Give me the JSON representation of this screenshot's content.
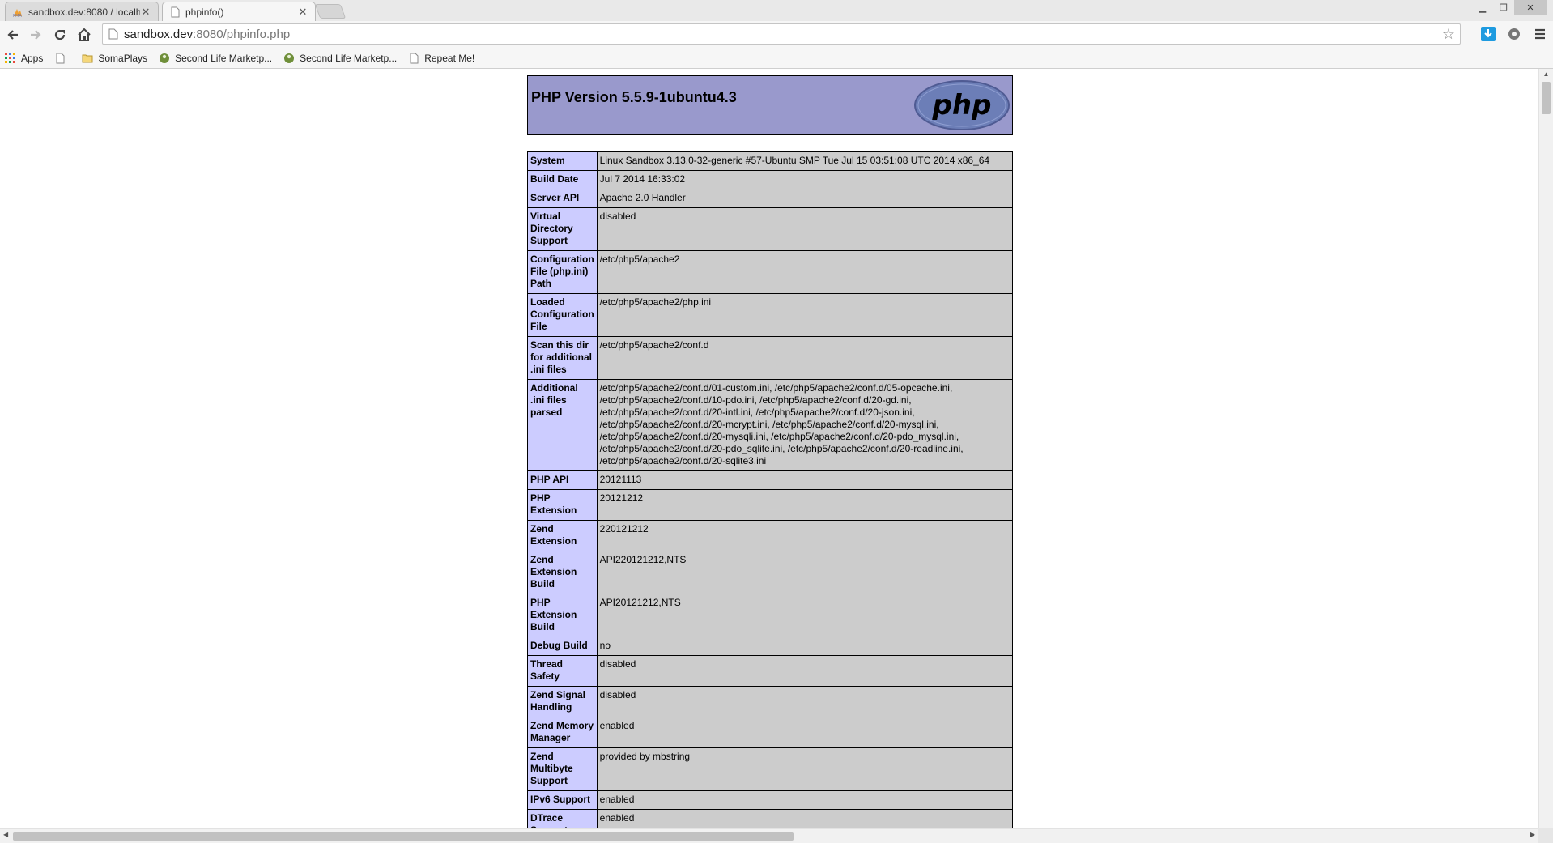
{
  "browser": {
    "tabs": [
      {
        "title": "sandbox.dev:8080 / localh",
        "active": false
      },
      {
        "title": "phpinfo()",
        "active": true
      }
    ],
    "address": {
      "host": "sandbox.dev",
      "path": ":8080/phpinfo.php"
    },
    "bookmarks": [
      {
        "label": "Apps",
        "icon": "apps-grid-icon"
      },
      {
        "label": "",
        "icon": "page-icon"
      },
      {
        "label": "SomaPlays",
        "icon": "folder-icon"
      },
      {
        "label": "Second Life Marketp...",
        "icon": "second-life-icon"
      },
      {
        "label": "Second Life Marketp...",
        "icon": "second-life-icon"
      },
      {
        "label": "Repeat Me!",
        "icon": "page-icon"
      }
    ]
  },
  "phpinfo": {
    "title": "PHP Version 5.5.9-1ubuntu4.3",
    "logo_text": "php",
    "rows": [
      {
        "k": "System",
        "v": "Linux Sandbox 3.13.0-32-generic #57-Ubuntu SMP Tue Jul 15 03:51:08 UTC 2014 x86_64"
      },
      {
        "k": "Build Date",
        "v": "Jul 7 2014 16:33:02"
      },
      {
        "k": "Server API",
        "v": "Apache 2.0 Handler"
      },
      {
        "k": "Virtual Directory Support",
        "v": "disabled"
      },
      {
        "k": "Configuration File (php.ini) Path",
        "v": "/etc/php5/apache2"
      },
      {
        "k": "Loaded Configuration File",
        "v": "/etc/php5/apache2/php.ini"
      },
      {
        "k": "Scan this dir for additional .ini files",
        "v": "/etc/php5/apache2/conf.d"
      },
      {
        "k": "Additional .ini files parsed",
        "v": "/etc/php5/apache2/conf.d/01-custom.ini, /etc/php5/apache2/conf.d/05-opcache.ini, /etc/php5/apache2/conf.d/10-pdo.ini, /etc/php5/apache2/conf.d/20-gd.ini, /etc/php5/apache2/conf.d/20-intl.ini, /etc/php5/apache2/conf.d/20-json.ini, /etc/php5/apache2/conf.d/20-mcrypt.ini, /etc/php5/apache2/conf.d/20-mysql.ini, /etc/php5/apache2/conf.d/20-mysqli.ini, /etc/php5/apache2/conf.d/20-pdo_mysql.ini, /etc/php5/apache2/conf.d/20-pdo_sqlite.ini, /etc/php5/apache2/conf.d/20-readline.ini, /etc/php5/apache2/conf.d/20-sqlite3.ini"
      },
      {
        "k": "PHP API",
        "v": "20121113"
      },
      {
        "k": "PHP Extension",
        "v": "20121212"
      },
      {
        "k": "Zend Extension",
        "v": "220121212"
      },
      {
        "k": "Zend Extension Build",
        "v": "API220121212,NTS"
      },
      {
        "k": "PHP Extension Build",
        "v": "API20121212,NTS"
      },
      {
        "k": "Debug Build",
        "v": "no"
      },
      {
        "k": "Thread Safety",
        "v": "disabled"
      },
      {
        "k": "Zend Signal Handling",
        "v": "disabled"
      },
      {
        "k": "Zend Memory Manager",
        "v": "enabled"
      },
      {
        "k": "Zend Multibyte Support",
        "v": "provided by mbstring"
      },
      {
        "k": "IPv6 Support",
        "v": "enabled"
      },
      {
        "k": "DTrace Support",
        "v": "enabled"
      }
    ]
  }
}
